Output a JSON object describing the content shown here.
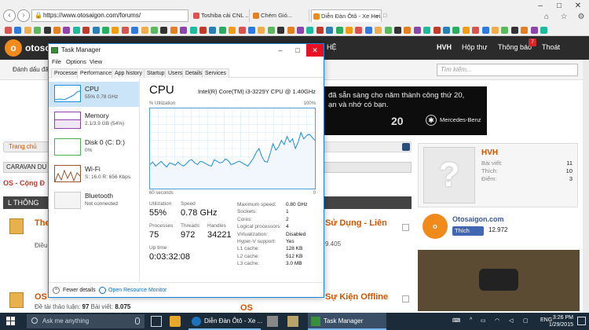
{
  "browser": {
    "address": "https://www.otosaigon.com/forums/",
    "tabs": [
      {
        "label": "Toshiba cải CNL ...",
        "color": "#d9534f"
      },
      {
        "label": "Chém Gió...",
        "color": "#e67e22"
      },
      {
        "label": "Diễn Đàn Ôtô - Xe Hơi Bốn ...",
        "color": "#f08a1c"
      }
    ],
    "close_glyph": "×"
  },
  "site": {
    "logo_text": "otosc",
    "logo_icon": "otosaigon-logo-icon",
    "nav_cut": "HỆ",
    "nav_user": "HVH",
    "nav_inbox": "Hộp thư",
    "nav_notifications": "Thông báo",
    "nav_notifications_badge": "7",
    "nav_logout": "Thoát",
    "mark_read": "Đánh dấu đã",
    "search_placeholder": "Tìm kiếm...",
    "banner": {
      "line1": "đã sẵn sàng cho năm thành công thứ 20,",
      "line2": "ạn và nhớ có bạn.",
      "twenty": "20",
      "brand": "Mercedes-Benz"
    },
    "breadcrumb": "Trang chủ",
    "caravan": "CARAVAN DU",
    "os_title": "OS - Cộng Đ",
    "forum_head": "L THÔNG",
    "forums": [
      {
        "title": "The",
        "title_right": "Sử Dụng - Liên",
        "sub": "Điều",
        "count_right": "9.405"
      },
      {
        "title": "OS",
        "title_right": "Sự Kiện Offline",
        "title_right2": "OS",
        "sub_label": "Đề tài thảo luận:",
        "threads": "97",
        "posts_label": "Bài viết:",
        "posts": "8.075"
      }
    ],
    "profile": {
      "name": "HVH",
      "stats": [
        {
          "label": "Bài viết:",
          "value": "11"
        },
        {
          "label": "Thích:",
          "value": "10"
        },
        {
          "label": "Điểm:",
          "value": "3"
        }
      ]
    },
    "fb": {
      "page": "Otosaigon.com",
      "like": "Thích",
      "count": "12.972"
    }
  },
  "taskmanager": {
    "title": "Task Manager",
    "menu": [
      "File",
      "Options",
      "View"
    ],
    "tabs": [
      "Processes",
      "Performance",
      "App history",
      "Startup",
      "Users",
      "Details",
      "Services"
    ],
    "active_tab": "Performance",
    "side": [
      {
        "name": "CPU",
        "value": "55% 0.78 GHz",
        "color": "#1c8fd6"
      },
      {
        "name": "Memory",
        "value": "2.1/3.9 GB (54%)",
        "color": "#8e44ad"
      },
      {
        "name": "Disk 0 (C: D:)",
        "value": "0%",
        "color": "#4caf50"
      },
      {
        "name": "Wi-Fi",
        "value": "S: 16.0  R: 656 Kbps",
        "color": "#a0522d"
      },
      {
        "name": "Bluetooth",
        "value": "Not connected",
        "color": "#999999"
      }
    ],
    "main": {
      "title": "CPU",
      "model": "Intel(R) Core(TM) i3-3229Y CPU @ 1.40GHz",
      "util_label": "% Utilization",
      "max_pct": "100%",
      "time_label": "60 seconds",
      "zero": "0",
      "utilization_label": "Utilization",
      "utilization": "55%",
      "speed_label": "Speed",
      "speed": "0.78 GHz",
      "processes_label": "Processes",
      "processes": "75",
      "threads_label": "Threads",
      "threads": "972",
      "handles_label": "Handles",
      "handles": "34221",
      "uptime_label": "Up time",
      "uptime": "0:03:32:08",
      "specs": [
        {
          "k": "Maximum speed:",
          "v": "0.80 GHz"
        },
        {
          "k": "Sockets:",
          "v": "1"
        },
        {
          "k": "Cores:",
          "v": "2"
        },
        {
          "k": "Logical processors:",
          "v": "4"
        },
        {
          "k": "Virtualization:",
          "v": "Disabled"
        },
        {
          "k": "Hyper-V support:",
          "v": "Yes"
        },
        {
          "k": "L1 cache:",
          "v": "128 KB"
        },
        {
          "k": "L2 cache:",
          "v": "512 KB"
        },
        {
          "k": "L3 cache:",
          "v": "3.0 MB"
        }
      ]
    },
    "footer": {
      "fewer": "Fewer details",
      "open": "Open Resource Monitor"
    }
  },
  "chart_data": {
    "type": "line",
    "ylim": [
      0,
      100
    ],
    "values": [
      30,
      33,
      28,
      31,
      34,
      30,
      27,
      32,
      31,
      29,
      33,
      30,
      28,
      31,
      35,
      36,
      32,
      30,
      34,
      33,
      31,
      29,
      28,
      36,
      34,
      32,
      33,
      37,
      35,
      30,
      31,
      33,
      34,
      32,
      30,
      28,
      33,
      38,
      45,
      50,
      40,
      34,
      33,
      44,
      56,
      48,
      52,
      60,
      55,
      65,
      58,
      62,
      50,
      58,
      70,
      62,
      66,
      68,
      64,
      60
    ]
  },
  "taskbar": {
    "search_placeholder": "Ask me anything",
    "apps": [
      {
        "label": "Diễn Đàn Ôtô - Xe ...",
        "active": false
      },
      {
        "label": "Task Manager",
        "active": true
      }
    ],
    "lang": "ENG",
    "time": "3:26 PM",
    "date": "1/29/2015"
  }
}
